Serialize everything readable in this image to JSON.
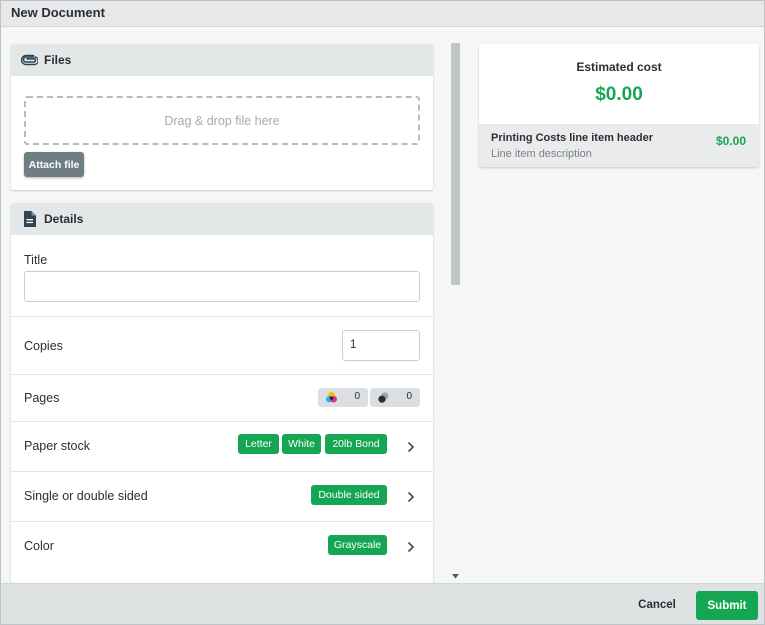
{
  "window": {
    "title": "New Document"
  },
  "files": {
    "header": "Files",
    "header_icon": "paperclip-icon",
    "dropzone_text": "Drag & drop file here",
    "attach_label": "Attach file"
  },
  "details": {
    "header": "Details",
    "header_icon": "document-icon",
    "title_label": "Title",
    "title_value": "",
    "copies_label": "Copies",
    "copies_value": "1",
    "pages_label": "Pages",
    "pages_color_count": "0",
    "pages_bw_count": "0",
    "paper_stock_label": "Paper stock",
    "paper_stock_tags": [
      "Letter",
      "White",
      "20lb Bond"
    ],
    "sided_label": "Single or double sided",
    "sided_tag": "Double sided",
    "color_label": "Color",
    "color_tag": "Grayscale"
  },
  "estimate": {
    "label": "Estimated cost",
    "total": "$0.00",
    "line_item_header": "Printing Costs line item header",
    "line_item_description": "Line item description",
    "line_item_amount": "$0.00"
  },
  "footer": {
    "cancel_label": "Cancel",
    "submit_label": "Submit"
  },
  "colors": {
    "accent_green": "#15a653",
    "attach_button": "#6f7e83",
    "header_bg": "#e4e7e7"
  }
}
